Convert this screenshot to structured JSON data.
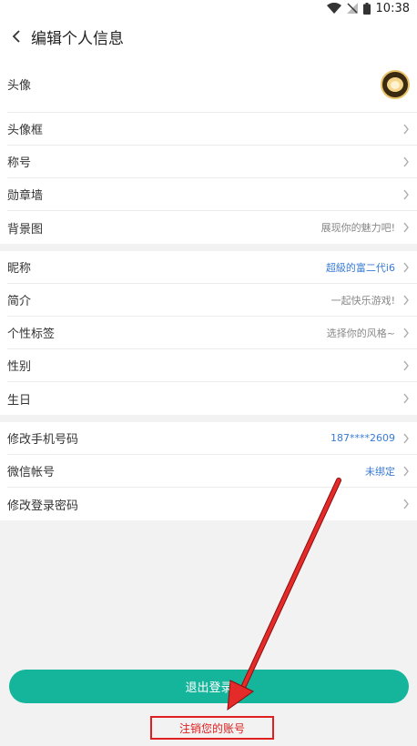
{
  "status": {
    "time": "10:38"
  },
  "header": {
    "title": "编辑个人信息"
  },
  "profile": [
    {
      "label": "头像",
      "value": ""
    },
    {
      "label": "头像框",
      "value": ""
    },
    {
      "label": "称号",
      "value": ""
    },
    {
      "label": "勋章墙",
      "value": ""
    },
    {
      "label": "背景图",
      "value": "展现你的魅力吧!"
    }
  ],
  "info": [
    {
      "label": "昵称",
      "value": "超級的富二代i6"
    },
    {
      "label": "简介",
      "value": "一起快乐游戏!"
    },
    {
      "label": "个性标签",
      "value": "选择你的风格~"
    },
    {
      "label": "性别",
      "value": ""
    },
    {
      "label": "生日",
      "value": ""
    }
  ],
  "account": [
    {
      "label": "修改手机号码",
      "value": "187****2609"
    },
    {
      "label": "微信帐号",
      "value": "未绑定"
    },
    {
      "label": "修改登录密码",
      "value": ""
    }
  ],
  "actions": {
    "logout": "退出登录",
    "cancel_account": "注销您的账号"
  },
  "colors": {
    "accent": "#14b59b",
    "highlight": "#e02020",
    "link": "#3a7bd5"
  }
}
